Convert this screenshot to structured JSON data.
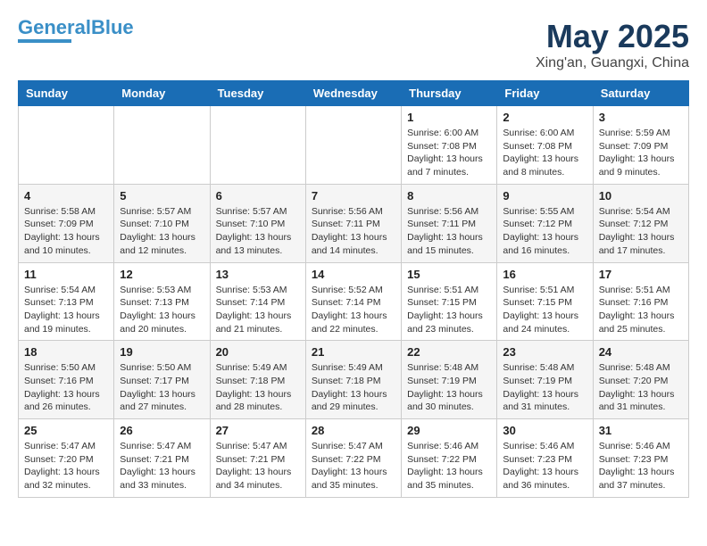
{
  "logo": {
    "part1": "General",
    "part2": "Blue"
  },
  "header": {
    "month": "May 2025",
    "location": "Xing'an, Guangxi, China"
  },
  "weekdays": [
    "Sunday",
    "Monday",
    "Tuesday",
    "Wednesday",
    "Thursday",
    "Friday",
    "Saturday"
  ],
  "weeks": [
    [
      {
        "day": "",
        "info": ""
      },
      {
        "day": "",
        "info": ""
      },
      {
        "day": "",
        "info": ""
      },
      {
        "day": "",
        "info": ""
      },
      {
        "day": "1",
        "info": "Sunrise: 6:00 AM\nSunset: 7:08 PM\nDaylight: 13 hours\nand 7 minutes."
      },
      {
        "day": "2",
        "info": "Sunrise: 6:00 AM\nSunset: 7:08 PM\nDaylight: 13 hours\nand 8 minutes."
      },
      {
        "day": "3",
        "info": "Sunrise: 5:59 AM\nSunset: 7:09 PM\nDaylight: 13 hours\nand 9 minutes."
      }
    ],
    [
      {
        "day": "4",
        "info": "Sunrise: 5:58 AM\nSunset: 7:09 PM\nDaylight: 13 hours\nand 10 minutes."
      },
      {
        "day": "5",
        "info": "Sunrise: 5:57 AM\nSunset: 7:10 PM\nDaylight: 13 hours\nand 12 minutes."
      },
      {
        "day": "6",
        "info": "Sunrise: 5:57 AM\nSunset: 7:10 PM\nDaylight: 13 hours\nand 13 minutes."
      },
      {
        "day": "7",
        "info": "Sunrise: 5:56 AM\nSunset: 7:11 PM\nDaylight: 13 hours\nand 14 minutes."
      },
      {
        "day": "8",
        "info": "Sunrise: 5:56 AM\nSunset: 7:11 PM\nDaylight: 13 hours\nand 15 minutes."
      },
      {
        "day": "9",
        "info": "Sunrise: 5:55 AM\nSunset: 7:12 PM\nDaylight: 13 hours\nand 16 minutes."
      },
      {
        "day": "10",
        "info": "Sunrise: 5:54 AM\nSunset: 7:12 PM\nDaylight: 13 hours\nand 17 minutes."
      }
    ],
    [
      {
        "day": "11",
        "info": "Sunrise: 5:54 AM\nSunset: 7:13 PM\nDaylight: 13 hours\nand 19 minutes."
      },
      {
        "day": "12",
        "info": "Sunrise: 5:53 AM\nSunset: 7:13 PM\nDaylight: 13 hours\nand 20 minutes."
      },
      {
        "day": "13",
        "info": "Sunrise: 5:53 AM\nSunset: 7:14 PM\nDaylight: 13 hours\nand 21 minutes."
      },
      {
        "day": "14",
        "info": "Sunrise: 5:52 AM\nSunset: 7:14 PM\nDaylight: 13 hours\nand 22 minutes."
      },
      {
        "day": "15",
        "info": "Sunrise: 5:51 AM\nSunset: 7:15 PM\nDaylight: 13 hours\nand 23 minutes."
      },
      {
        "day": "16",
        "info": "Sunrise: 5:51 AM\nSunset: 7:15 PM\nDaylight: 13 hours\nand 24 minutes."
      },
      {
        "day": "17",
        "info": "Sunrise: 5:51 AM\nSunset: 7:16 PM\nDaylight: 13 hours\nand 25 minutes."
      }
    ],
    [
      {
        "day": "18",
        "info": "Sunrise: 5:50 AM\nSunset: 7:16 PM\nDaylight: 13 hours\nand 26 minutes."
      },
      {
        "day": "19",
        "info": "Sunrise: 5:50 AM\nSunset: 7:17 PM\nDaylight: 13 hours\nand 27 minutes."
      },
      {
        "day": "20",
        "info": "Sunrise: 5:49 AM\nSunset: 7:18 PM\nDaylight: 13 hours\nand 28 minutes."
      },
      {
        "day": "21",
        "info": "Sunrise: 5:49 AM\nSunset: 7:18 PM\nDaylight: 13 hours\nand 29 minutes."
      },
      {
        "day": "22",
        "info": "Sunrise: 5:48 AM\nSunset: 7:19 PM\nDaylight: 13 hours\nand 30 minutes."
      },
      {
        "day": "23",
        "info": "Sunrise: 5:48 AM\nSunset: 7:19 PM\nDaylight: 13 hours\nand 31 minutes."
      },
      {
        "day": "24",
        "info": "Sunrise: 5:48 AM\nSunset: 7:20 PM\nDaylight: 13 hours\nand 31 minutes."
      }
    ],
    [
      {
        "day": "25",
        "info": "Sunrise: 5:47 AM\nSunset: 7:20 PM\nDaylight: 13 hours\nand 32 minutes."
      },
      {
        "day": "26",
        "info": "Sunrise: 5:47 AM\nSunset: 7:21 PM\nDaylight: 13 hours\nand 33 minutes."
      },
      {
        "day": "27",
        "info": "Sunrise: 5:47 AM\nSunset: 7:21 PM\nDaylight: 13 hours\nand 34 minutes."
      },
      {
        "day": "28",
        "info": "Sunrise: 5:47 AM\nSunset: 7:22 PM\nDaylight: 13 hours\nand 35 minutes."
      },
      {
        "day": "29",
        "info": "Sunrise: 5:46 AM\nSunset: 7:22 PM\nDaylight: 13 hours\nand 35 minutes."
      },
      {
        "day": "30",
        "info": "Sunrise: 5:46 AM\nSunset: 7:23 PM\nDaylight: 13 hours\nand 36 minutes."
      },
      {
        "day": "31",
        "info": "Sunrise: 5:46 AM\nSunset: 7:23 PM\nDaylight: 13 hours\nand 37 minutes."
      }
    ]
  ]
}
